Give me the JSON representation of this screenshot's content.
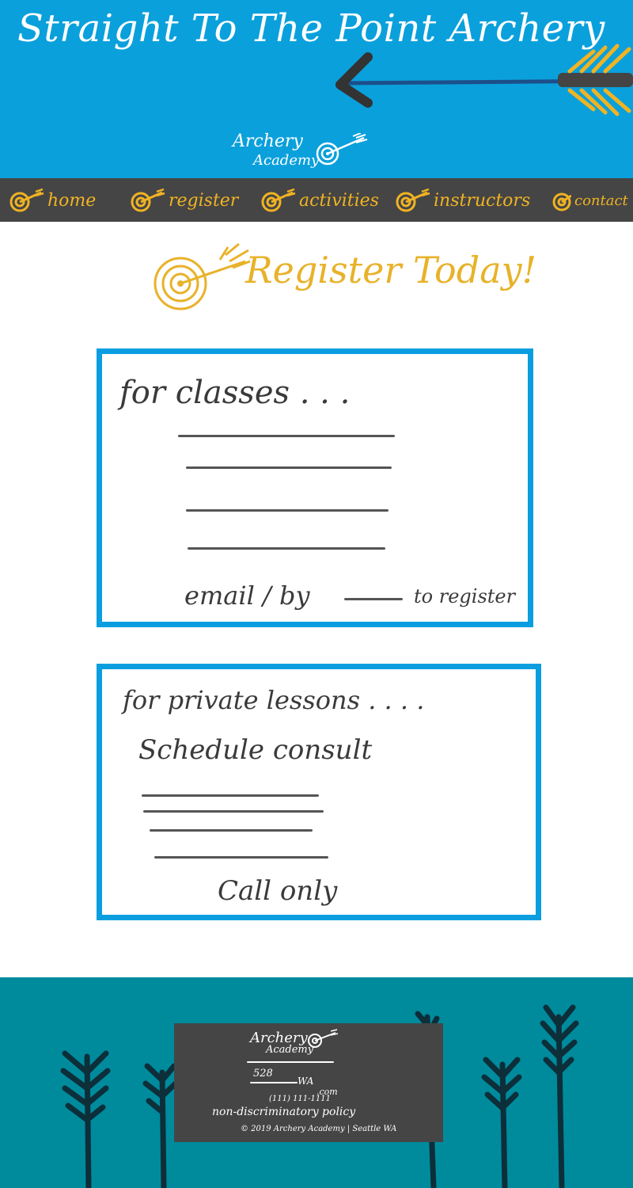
{
  "header": {
    "site_title": "Straight To The Point Archery",
    "logo": {
      "line1": "Archery",
      "line2": "Academy"
    }
  },
  "nav": {
    "items": [
      {
        "label": "home"
      },
      {
        "label": "register"
      },
      {
        "label": "activities"
      },
      {
        "label": "instructors"
      },
      {
        "label": "contact"
      }
    ]
  },
  "page": {
    "heading": "Register Today!"
  },
  "classes_card": {
    "title": "for classes . . .",
    "footer_note": "email / by",
    "footer_suffix": "to register"
  },
  "private_card": {
    "title": "for private lessons . . . .",
    "subtitle": "Schedule consult",
    "footer_note": "Call only"
  },
  "footer": {
    "logo_line1": "Archery",
    "logo_line2": "Academy",
    "address_number": "528",
    "address_state": "WA",
    "email_suffix": ".com",
    "phone": "(111) 111-1111",
    "policy": "non-discriminatory policy",
    "copyright": "© 2019 Archery Academy | Seattle WA"
  },
  "colors": {
    "header_blue": "#0aa0dc",
    "nav_gray": "#454545",
    "accent_gold": "#e8b229",
    "card_border_blue": "#0a9ee0",
    "footer_teal": "#008b9d"
  }
}
